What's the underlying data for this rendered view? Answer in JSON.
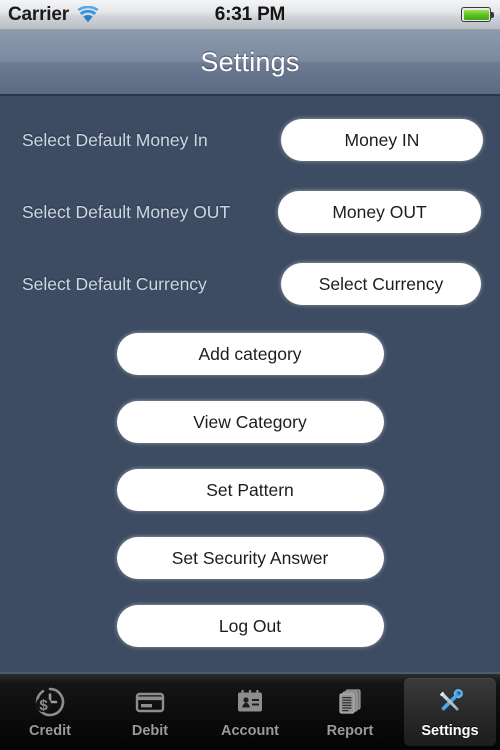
{
  "status_bar": {
    "carrier": "Carrier",
    "wifi_icon": "wifi-icon",
    "time": "6:31 PM",
    "battery_icon": "battery-full-icon"
  },
  "nav_bar": {
    "title": "Settings"
  },
  "theme": {
    "background": "#3e4c63",
    "nav_gradient_top": "#8d9aae",
    "nav_gradient_bottom": "#5b6a82",
    "label_color": "#cfd7e4",
    "button_bg": "#ffffff",
    "button_text": "#1d1d1d",
    "tabbar_bg": "#0b0b0b",
    "tab_selected_text": "#ffffff",
    "tab_icon_accent": "#3aa3e6"
  },
  "settings_rows": [
    {
      "label": "Select Default Money In",
      "button_label": "Money IN"
    },
    {
      "label": "Select Default Money OUT",
      "button_label": "Money OUT"
    },
    {
      "label": "Select Default Currency",
      "button_label": "Select Currency"
    }
  ],
  "action_buttons": [
    {
      "label": "Add category"
    },
    {
      "label": "View Category"
    },
    {
      "label": "Set Pattern"
    },
    {
      "label": "Set Security Answer"
    },
    {
      "label": "Log Out"
    }
  ],
  "tab_bar": {
    "tabs": [
      {
        "label": "Credit",
        "icon": "clock-dollar-icon",
        "selected": false
      },
      {
        "label": "Debit",
        "icon": "credit-card-icon",
        "selected": false
      },
      {
        "label": "Account",
        "icon": "contact-card-icon",
        "selected": false
      },
      {
        "label": "Report",
        "icon": "document-stack-icon",
        "selected": false
      },
      {
        "label": "Settings",
        "icon": "tools-icon",
        "selected": true
      }
    ]
  }
}
